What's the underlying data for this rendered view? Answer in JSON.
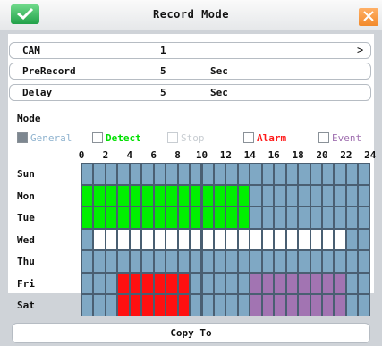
{
  "window": {
    "title": "Record Mode"
  },
  "fields": [
    {
      "label": "CAM",
      "value": "1",
      "unit": "",
      "chevron": ">"
    },
    {
      "label": "PreRecord",
      "value": "5",
      "unit": "Sec",
      "chevron": ""
    },
    {
      "label": "Delay",
      "value": "5",
      "unit": "Sec",
      "chevron": ""
    }
  ],
  "mode": {
    "label": "Mode",
    "legend": [
      {
        "key": "general",
        "label": "General",
        "color": "#8fb3cf",
        "checked": true
      },
      {
        "key": "detect",
        "label": "Detect",
        "color": "#00e000",
        "checked": false
      },
      {
        "key": "stop",
        "label": "Stop",
        "color": "#c8cdd2",
        "checked": false
      },
      {
        "key": "alarm",
        "label": "Alarm",
        "color": "#ff1a1a",
        "checked": false
      },
      {
        "key": "event",
        "label": "Event",
        "color": "#a070b0",
        "checked": false
      }
    ]
  },
  "hour_labels": [
    "0",
    "2",
    "4",
    "6",
    "8",
    "10",
    "12",
    "14",
    "16",
    "18",
    "20",
    "22",
    "24"
  ],
  "days": [
    "Sun",
    "Mon",
    "Tue",
    "Wed",
    "Thu",
    "Fri",
    "Sat"
  ],
  "colors": {
    "general": "#7fa8c4",
    "detect": "#00f000",
    "stop": "#ffffff",
    "alarm": "#ff1010",
    "event": "#a274b2",
    "grid_line": "#4a5f72"
  },
  "schedule": [
    [
      "general",
      "general",
      "general",
      "general",
      "general",
      "general",
      "general",
      "general",
      "general",
      "general",
      "general",
      "general",
      "general",
      "general",
      "general",
      "general",
      "general",
      "general",
      "general",
      "general",
      "general",
      "general",
      "general",
      "general"
    ],
    [
      "detect",
      "detect",
      "detect",
      "detect",
      "detect",
      "detect",
      "detect",
      "detect",
      "detect",
      "detect",
      "detect",
      "detect",
      "detect",
      "detect",
      "general",
      "general",
      "general",
      "general",
      "general",
      "general",
      "general",
      "general",
      "general",
      "general"
    ],
    [
      "detect",
      "detect",
      "detect",
      "detect",
      "detect",
      "detect",
      "detect",
      "detect",
      "detect",
      "detect",
      "detect",
      "detect",
      "detect",
      "detect",
      "general",
      "general",
      "general",
      "general",
      "general",
      "general",
      "general",
      "general",
      "general",
      "general"
    ],
    [
      "general",
      "stop",
      "stop",
      "stop",
      "stop",
      "stop",
      "stop",
      "stop",
      "stop",
      "stop",
      "stop",
      "stop",
      "stop",
      "stop",
      "stop",
      "stop",
      "stop",
      "stop",
      "stop",
      "stop",
      "stop",
      "stop",
      "general",
      "general"
    ],
    [
      "general",
      "general",
      "general",
      "general",
      "general",
      "general",
      "general",
      "general",
      "general",
      "general",
      "general",
      "general",
      "general",
      "general",
      "general",
      "general",
      "general",
      "general",
      "general",
      "general",
      "general",
      "general",
      "general",
      "general"
    ],
    [
      "general",
      "general",
      "general",
      "alarm",
      "alarm",
      "alarm",
      "alarm",
      "alarm",
      "alarm",
      "general",
      "general",
      "general",
      "general",
      "general",
      "event",
      "event",
      "event",
      "event",
      "event",
      "event",
      "event",
      "event",
      "general",
      "general"
    ],
    [
      "general",
      "general",
      "general",
      "alarm",
      "alarm",
      "alarm",
      "alarm",
      "alarm",
      "alarm",
      "general",
      "general",
      "general",
      "general",
      "general",
      "event",
      "event",
      "event",
      "event",
      "event",
      "event",
      "event",
      "event",
      "general",
      "general"
    ]
  ],
  "actions": {
    "copy_to": "Copy To"
  }
}
